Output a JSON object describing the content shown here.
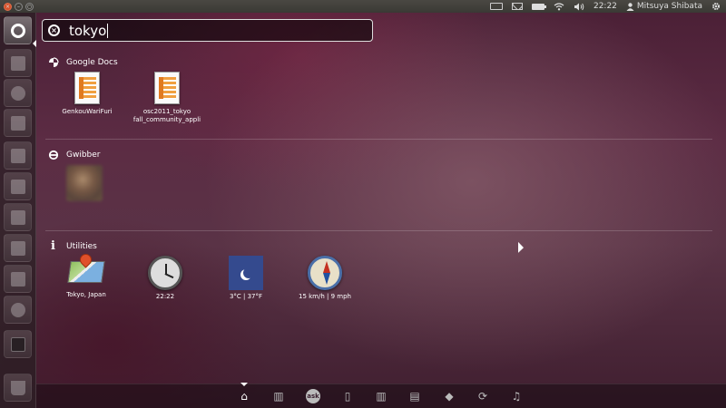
{
  "top_panel": {
    "time": "22:22",
    "user": "Mitsuya Shibata",
    "icons": [
      "keyboard-icon",
      "mail-icon",
      "battery-icon",
      "wifi-icon",
      "volume-icon",
      "user-icon",
      "gear-icon"
    ]
  },
  "window_buttons": {
    "close": "×",
    "minimize": "–",
    "maximize": "○"
  },
  "launcher": {
    "items": [
      "dash-home",
      "home-folder",
      "firefox",
      "workspaces",
      "libreoffice-writer",
      "libreoffice-calc",
      "libreoffice-impress",
      "ubuntu-software-center",
      "ubuntu-one",
      "system-settings",
      "terminal",
      "trash"
    ]
  },
  "search": {
    "query": "tokyo"
  },
  "sections": [
    {
      "title": "Google Docs",
      "icon": "google-docs-icon",
      "items": [
        {
          "label_line1": "GenkouWariFuri",
          "label_line2": ""
        },
        {
          "label_line1": "osc2011_tokyo",
          "label_line2": "fall_community_appli"
        }
      ]
    },
    {
      "title": "Gwibber",
      "icon": "gwibber-icon",
      "items": [
        {
          "label_line1": "",
          "label_line2": ""
        }
      ]
    },
    {
      "title": "Utilities",
      "icon": "info-icon",
      "items": [
        {
          "label_line1": "Tokyo, Japan",
          "label_line2": ""
        },
        {
          "label_line1": "22:22",
          "label_line2": ""
        },
        {
          "label_line1": "3°C | 37°F",
          "label_line2": ""
        },
        {
          "label_line1": "15 km/h | 9 mph",
          "label_line2": ""
        }
      ]
    }
  ],
  "lens_bar": {
    "lenses": [
      {
        "name": "home",
        "glyph": "⌂"
      },
      {
        "name": "applications",
        "glyph": "▥"
      },
      {
        "name": "ask",
        "glyph": "ask"
      },
      {
        "name": "bookmarks",
        "glyph": "▯"
      },
      {
        "name": "books",
        "glyph": "▥"
      },
      {
        "name": "files",
        "glyph": "▤"
      },
      {
        "name": "python",
        "glyph": "◆"
      },
      {
        "name": "gwibber",
        "glyph": "⟳"
      },
      {
        "name": "music",
        "glyph": "♫"
      }
    ]
  }
}
